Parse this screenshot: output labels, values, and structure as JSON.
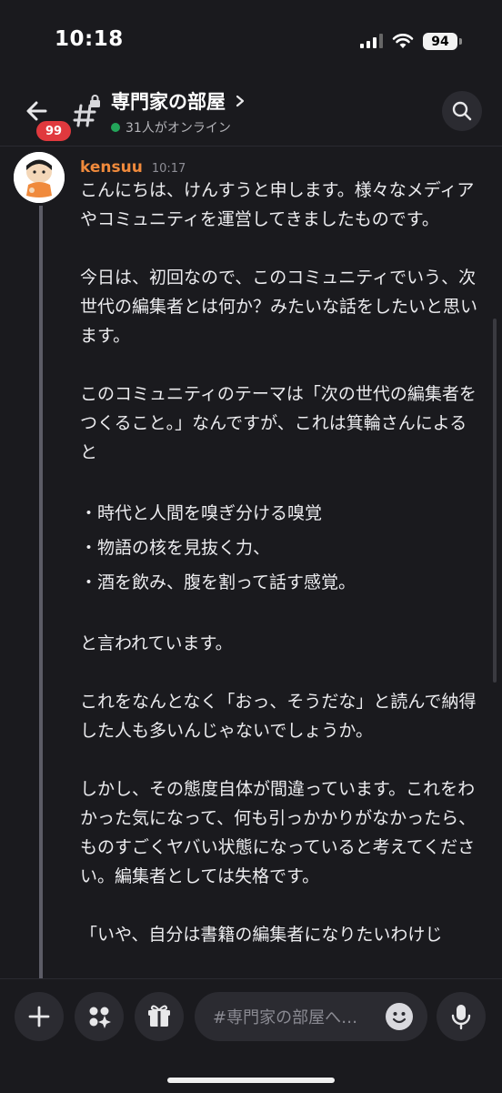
{
  "status_bar": {
    "time": "10:18",
    "battery": "94"
  },
  "header": {
    "unread_badge": "99",
    "channel_name": "専門家の部屋",
    "online_text": "31人がオンライン"
  },
  "message": {
    "author": "kensuu",
    "time": "10:17",
    "paragraphs": [
      "こんにちは、けんすうと申します。様々なメディアやコミュニティを運営してきましたものです。",
      "今日は、初回なので、このコミュニティでいう、次世代の編集者とは何か？みたいな話をしたいと思います。",
      "このコミュニティのテーマは「次の世代の編集者をつくること。」なんですが、これは箕輪さんによると",
      "・時代と人間を嗅ぎ分ける嗅覚",
      "・物語の核を見抜く力、",
      "・酒を飲み、腹を割って話す感覚。",
      "と言われています。",
      "これをなんとなく「おっ、そうだな」と読んで納得した人も多いんじゃないでしょうか。",
      "しかし、その態度自体が間違っています。これをわかった気になって、何も引っかかりがなかったら、ものすごくヤバい状態になっていると考えてください。編集者としては失格です。",
      "「いや、自分は書籍の編集者になりたいわけじ"
    ]
  },
  "composer": {
    "placeholder": "#専門家の部屋へ…"
  },
  "icons": {
    "back": "arrow-left-icon",
    "channel": "locked-hash-icon",
    "search": "search-icon",
    "add": "plus-icon",
    "apps": "apps-sparkle-icon",
    "gift": "gift-icon",
    "emoji": "emoji-icon",
    "mic": "microphone-icon"
  },
  "colors": {
    "background": "#1a1a1e",
    "author": "#f08a3c",
    "badge": "#e0393e",
    "online": "#23a55a"
  }
}
